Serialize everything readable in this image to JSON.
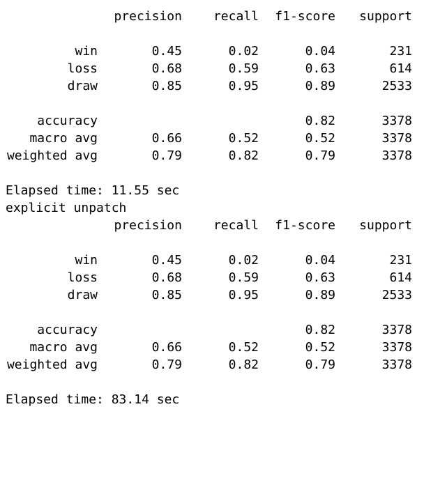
{
  "reports": [
    {
      "headers": {
        "precision": "precision",
        "recall": "recall",
        "f1": "f1-score",
        "support": "support"
      },
      "rows": [
        {
          "label": "win",
          "precision": "0.45",
          "recall": "0.02",
          "f1": "0.04",
          "support": "231"
        },
        {
          "label": "loss",
          "precision": "0.68",
          "recall": "0.59",
          "f1": "0.63",
          "support": "614"
        },
        {
          "label": "draw",
          "precision": "0.85",
          "recall": "0.95",
          "f1": "0.89",
          "support": "2533"
        }
      ],
      "summary": [
        {
          "label": "accuracy",
          "precision": "",
          "recall": "",
          "f1": "0.82",
          "support": "3378"
        },
        {
          "label": "macro avg",
          "precision": "0.66",
          "recall": "0.52",
          "f1": "0.52",
          "support": "3378"
        },
        {
          "label": "weighted avg",
          "precision": "0.79",
          "recall": "0.82",
          "f1": "0.79",
          "support": "3378"
        }
      ],
      "elapsed": "Elapsed time: 11.55 sec"
    },
    {
      "headers": {
        "precision": "precision",
        "recall": "recall",
        "f1": "f1-score",
        "support": "support"
      },
      "rows": [
        {
          "label": "win",
          "precision": "0.45",
          "recall": "0.02",
          "f1": "0.04",
          "support": "231"
        },
        {
          "label": "loss",
          "precision": "0.68",
          "recall": "0.59",
          "f1": "0.63",
          "support": "614"
        },
        {
          "label": "draw",
          "precision": "0.85",
          "recall": "0.95",
          "f1": "0.89",
          "support": "2533"
        }
      ],
      "summary": [
        {
          "label": "accuracy",
          "precision": "",
          "recall": "",
          "f1": "0.82",
          "support": "3378"
        },
        {
          "label": "macro avg",
          "precision": "0.66",
          "recall": "0.52",
          "f1": "0.52",
          "support": "3378"
        },
        {
          "label": "weighted avg",
          "precision": "0.79",
          "recall": "0.82",
          "f1": "0.79",
          "support": "3378"
        }
      ],
      "elapsed": "Elapsed time: 83.14 sec"
    }
  ],
  "between_text": "explicit unpatch"
}
